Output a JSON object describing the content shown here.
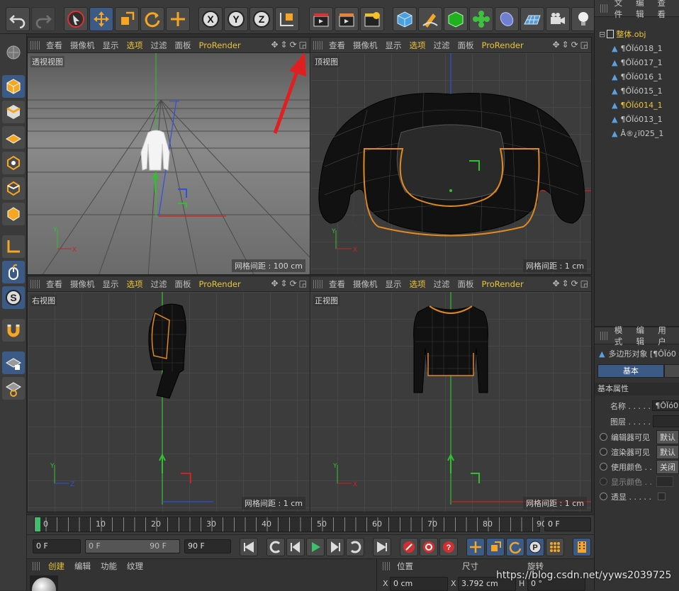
{
  "viewport_menu": [
    "查看",
    "摄像机",
    "显示",
    "选项",
    "过滤",
    "面板",
    "ProRender"
  ],
  "viewports": {
    "perspective": {
      "name": "透视视图",
      "grid": "网格间距 : 100 cm"
    },
    "top": {
      "name": "顶视图",
      "grid": "网格间距 : 1 cm"
    },
    "right": {
      "name": "右视图",
      "grid": "网格间距 : 1 cm"
    },
    "front": {
      "name": "正视图",
      "grid": "网格间距 : 1 cm"
    }
  },
  "axes": {
    "x": "X",
    "y": "Y",
    "z": "Z"
  },
  "toolbar": {
    "axis_x": "X",
    "axis_y": "Y",
    "axis_z": "Z"
  },
  "object_manager": {
    "menu": [
      "文件",
      "编辑",
      "查看"
    ],
    "root": "整体.obj",
    "items": [
      "¶ÔÏó018_1",
      "¶ÔÏó017_1",
      "¶ÔÏó016_1",
      "¶ÔÏó015_1",
      "¶ÔÏó014_1",
      "¶ÔÏó013_1",
      "Â®¿ï025_1"
    ],
    "active_index": 4
  },
  "attributes": {
    "menu": [
      "模式",
      "编辑",
      "用户"
    ],
    "object_type": "多边形对象 [¶ÔÏó0",
    "tab_basic": "基本",
    "section": "基本属性",
    "rows": [
      {
        "label": "名称 . . . . .",
        "value": "¶ÔÏó0"
      },
      {
        "label": "图层 . . . . .",
        "value": ""
      },
      {
        "label": "编辑器可见",
        "value": "默认"
      },
      {
        "label": "渲染器可见",
        "value": "默认"
      },
      {
        "label": "使用颜色 . .",
        "value": "关闭"
      },
      {
        "label": "显示颜色 . .",
        "value": ""
      },
      {
        "label": "透显 . . . . .",
        "value": ""
      }
    ]
  },
  "timeline": {
    "ticks": [
      "0",
      "10",
      "20",
      "30",
      "40",
      "50",
      "60",
      "70",
      "80",
      "90"
    ],
    "current_frame": "0 F"
  },
  "controls": {
    "start": "0 F",
    "range_start": "0 F",
    "range_end": "90 F",
    "end": "90 F"
  },
  "material_menu": [
    "创建",
    "编辑",
    "功能",
    "纹理"
  ],
  "coords": {
    "headers": [
      "位置",
      "尺寸",
      "旋转"
    ],
    "x_label": "X",
    "x_pos": "0 cm",
    "x_label2": "X",
    "x_size": "3.792 cm",
    "h_label": "H",
    "h_rot": "0 °"
  },
  "watermark": "https://blog.csdn.net/yyws2039725",
  "colors": {
    "accent": "#e8c43a",
    "selected_bg": "#3b5a86",
    "axis_x": "#d02020",
    "axis_y": "#20c020",
    "axis_z": "#3050e0",
    "wire": "#111111",
    "outline": "#e08a20"
  }
}
